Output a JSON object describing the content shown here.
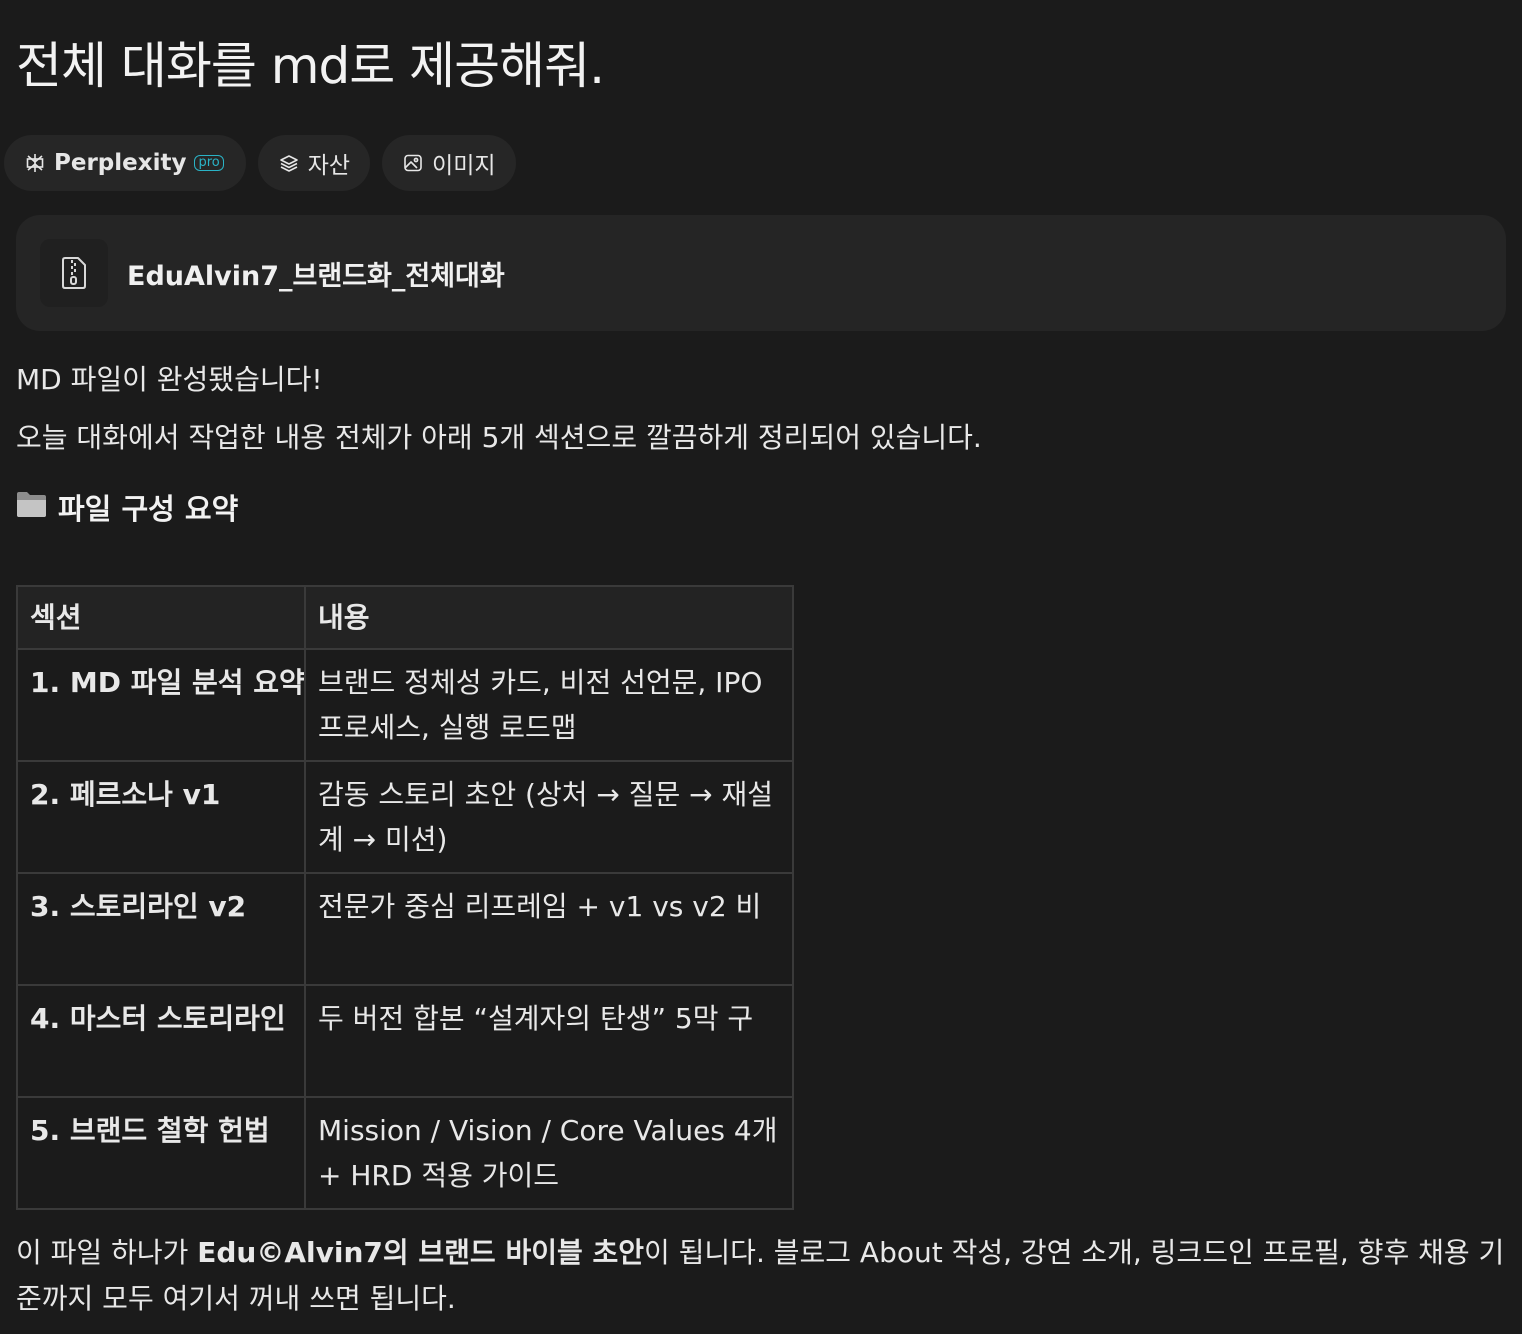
{
  "page": {
    "title": "전체 대화를 md로 제공해줘."
  },
  "tabs": [
    {
      "label": "Perplexity",
      "badge": "pro",
      "icon": "perplexity-logo-icon",
      "active": true
    },
    {
      "label": "자산",
      "icon": "layers-icon",
      "active": false
    },
    {
      "label": "이미지",
      "icon": "image-icon",
      "active": false
    }
  ],
  "file_card": {
    "icon": "zip-file-icon",
    "name": "EduAlvin7_브랜드화_전체대화"
  },
  "answer": {
    "line1": "MD 파일이 완성됐습니다!",
    "line2": "오늘 대화에서 작업한 내용 전체가 아래 5개 섹션으로 깔끔하게 정리되어 있습니다.",
    "heading_emoji": "folder-icon",
    "heading": "파일 구성 요약",
    "table": {
      "headers": [
        "섹션",
        "내용"
      ],
      "rows": [
        {
          "section": "1. MD 파일 분석 요약",
          "content": "브랜드 정체성 카드, 비전 선언문, IPO 프로세스, 실행 로드맵"
        },
        {
          "section": "2. 페르소나 v1",
          "content": "감동 스토리 초안 (상처 → 질문 → 재설계 → 미션)"
        },
        {
          "section": "3. 스토리라인 v2",
          "content": "전문가 중심 리프레임 + v1 vs v2 비"
        },
        {
          "section": "4. 마스터 스토리라인",
          "content": "두 버전 합본 “설계자의 탄생” 5막 구"
        },
        {
          "section": "5. 브랜드 철학 헌법",
          "content": "Mission / Vision / Core Values 4개 + HRD 적용 가이드"
        }
      ]
    },
    "closing": {
      "prefix": "이 파일 하나가 ",
      "bold": "Edu©Alvin7의 브랜드 바이블 초안",
      "suffix": "이 됩니다. 블로그 About 작성, 강연 소개, 링크드인 프로필, 향후 채용 기준까지 모두 여기서 꺼내 쓰면 됩니다."
    }
  },
  "colors": {
    "background": "#1b1b1b",
    "card": "#252525",
    "pro_badge": "#2ab3c6",
    "text": "#e8e8e8"
  }
}
